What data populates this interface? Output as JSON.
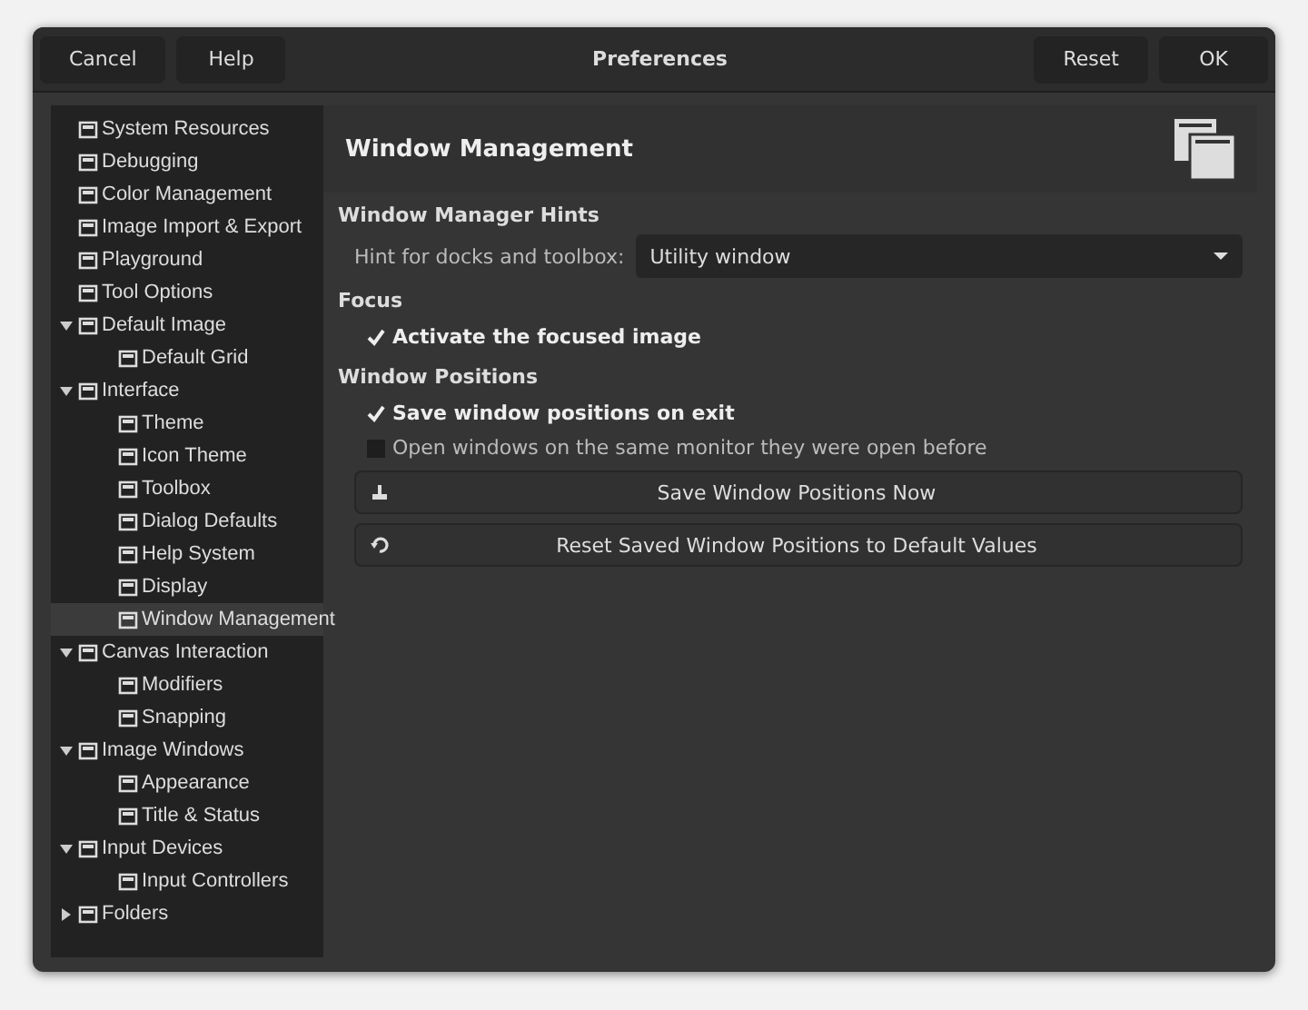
{
  "window": {
    "title": "Preferences"
  },
  "header": {
    "left_buttons": [
      "Cancel",
      "Help"
    ],
    "right_buttons": [
      "Reset",
      "OK"
    ]
  },
  "sidebar": {
    "items": [
      {
        "label": "System Resources",
        "selected": false
      },
      {
        "label": "Debugging",
        "selected": false
      },
      {
        "label": "Color Management",
        "selected": false
      },
      {
        "label": "Image Import & Export",
        "selected": false
      },
      {
        "label": "Playground",
        "selected": false
      },
      {
        "label": "Tool Options",
        "selected": false
      },
      {
        "label": "Default Image",
        "selected": false,
        "expanded": true,
        "children": [
          {
            "label": "Default Grid",
            "selected": false
          }
        ]
      },
      {
        "label": "Interface",
        "selected": false,
        "expanded": true,
        "children": [
          {
            "label": "Theme",
            "selected": false
          },
          {
            "label": "Icon Theme",
            "selected": false
          },
          {
            "label": "Toolbox",
            "selected": false
          },
          {
            "label": "Dialog Defaults",
            "selected": false
          },
          {
            "label": "Help System",
            "selected": false
          },
          {
            "label": "Display",
            "selected": false
          },
          {
            "label": "Window Management",
            "selected": true
          }
        ]
      },
      {
        "label": "Canvas Interaction",
        "selected": false,
        "expanded": true,
        "children": [
          {
            "label": "Modifiers",
            "selected": false
          },
          {
            "label": "Snapping",
            "selected": false
          }
        ]
      },
      {
        "label": "Image Windows",
        "selected": false,
        "expanded": true,
        "children": [
          {
            "label": "Appearance",
            "selected": false
          },
          {
            "label": "Title & Status",
            "selected": false
          }
        ]
      },
      {
        "label": "Input Devices",
        "selected": false,
        "expanded": true,
        "children": [
          {
            "label": "Input Controllers",
            "selected": false
          }
        ]
      },
      {
        "label": "Folders",
        "selected": false,
        "expanded": false
      }
    ]
  },
  "content": {
    "title": "Window Management",
    "sections": [
      {
        "heading": "Window Manager Hints",
        "rows": [
          {
            "kind": "dropdown",
            "label": "Hint for docks and toolbox:",
            "value": "Utility window"
          }
        ]
      },
      {
        "heading": "Focus",
        "rows": [
          {
            "kind": "checkbox",
            "label": "Activate the focused image",
            "checked": true
          }
        ]
      },
      {
        "heading": "Window Positions",
        "rows": [
          {
            "kind": "checkbox",
            "label": "Save window positions on exit",
            "checked": true
          },
          {
            "kind": "checkbox",
            "label": "Open windows on the same monitor they were open before",
            "checked": false
          },
          {
            "kind": "button",
            "label": "Save Window Positions Now"
          },
          {
            "kind": "button",
            "label": "Reset Saved Window Positions to Default Values"
          }
        ]
      }
    ]
  }
}
